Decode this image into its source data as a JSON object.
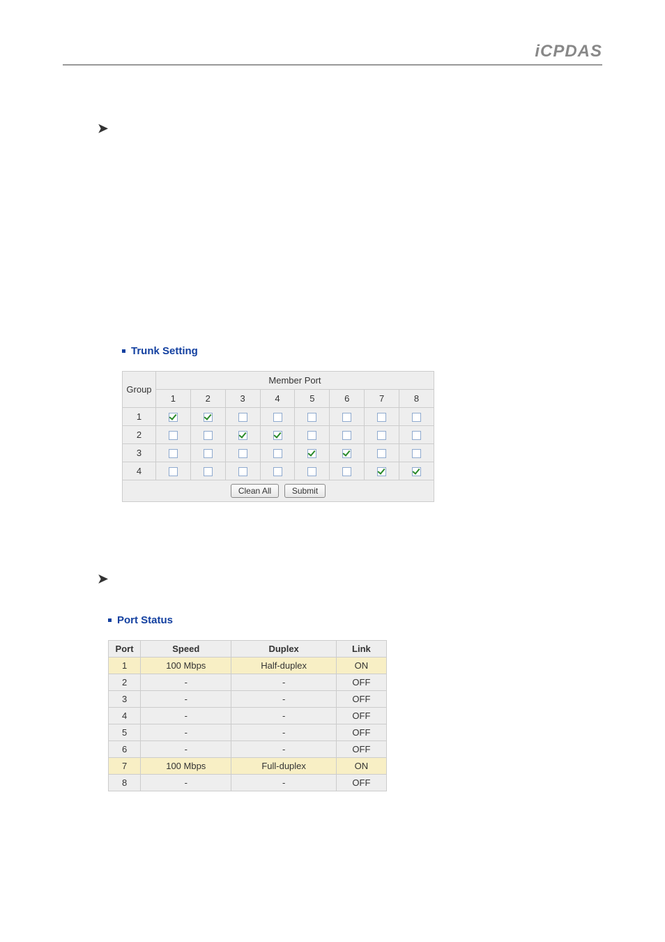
{
  "logo_text": "iCPDAS",
  "trunk": {
    "title": "Trunk Setting",
    "group_header": "Group",
    "member_header": "Member Port",
    "ports": [
      "1",
      "2",
      "3",
      "4",
      "5",
      "6",
      "7",
      "8"
    ],
    "groups": [
      {
        "label": "1",
        "cells": [
          true,
          true,
          false,
          false,
          false,
          false,
          false,
          false
        ]
      },
      {
        "label": "2",
        "cells": [
          false,
          false,
          true,
          true,
          false,
          false,
          false,
          false
        ]
      },
      {
        "label": "3",
        "cells": [
          false,
          false,
          false,
          false,
          true,
          true,
          false,
          false
        ]
      },
      {
        "label": "4",
        "cells": [
          false,
          false,
          false,
          false,
          false,
          false,
          true,
          true
        ]
      }
    ],
    "btn_clean": "Clean All",
    "btn_submit": "Submit"
  },
  "status": {
    "title": "Port Status",
    "headers": {
      "port": "Port",
      "speed": "Speed",
      "duplex": "Duplex",
      "link": "Link"
    },
    "rows": [
      {
        "port": "1",
        "speed": "100 Mbps",
        "duplex": "Half-duplex",
        "link": "ON",
        "on": true
      },
      {
        "port": "2",
        "speed": "-",
        "duplex": "-",
        "link": "OFF",
        "on": false
      },
      {
        "port": "3",
        "speed": "-",
        "duplex": "-",
        "link": "OFF",
        "on": false
      },
      {
        "port": "4",
        "speed": "-",
        "duplex": "-",
        "link": "OFF",
        "on": false
      },
      {
        "port": "5",
        "speed": "-",
        "duplex": "-",
        "link": "OFF",
        "on": false
      },
      {
        "port": "6",
        "speed": "-",
        "duplex": "-",
        "link": "OFF",
        "on": false
      },
      {
        "port": "7",
        "speed": "100 Mbps",
        "duplex": "Full-duplex",
        "link": "ON",
        "on": true
      },
      {
        "port": "8",
        "speed": "-",
        "duplex": "-",
        "link": "OFF",
        "on": false
      }
    ]
  }
}
